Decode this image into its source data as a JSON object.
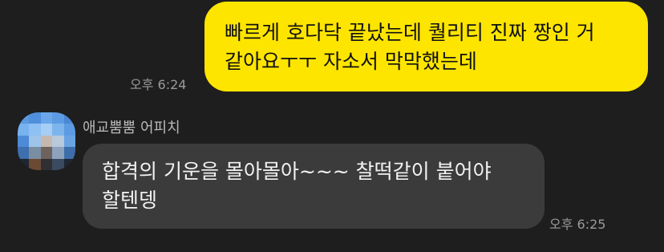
{
  "outgoing": {
    "lines": [
      "빠르게 호다닥 끝났는데 퀄리티 진짜 짱인 거",
      "같아요ㅜㅜ 자소서 막막했는데"
    ],
    "time": "오후 6:24",
    "bubble_color": "#fee500"
  },
  "incoming": {
    "sender_name": "애교뿜뿜 어피치",
    "avatar_icon": "pixelated-profile-avatar",
    "lines": [
      "합격의 기운을 몰아몰아~~~ 찰떡같이 붙어야",
      "할텐뎅"
    ],
    "time": "오후 6:25",
    "bubble_color": "#3b3b3b"
  },
  "colors": {
    "background": "#1e1e1e",
    "timestamp": "#9a9a9a"
  }
}
